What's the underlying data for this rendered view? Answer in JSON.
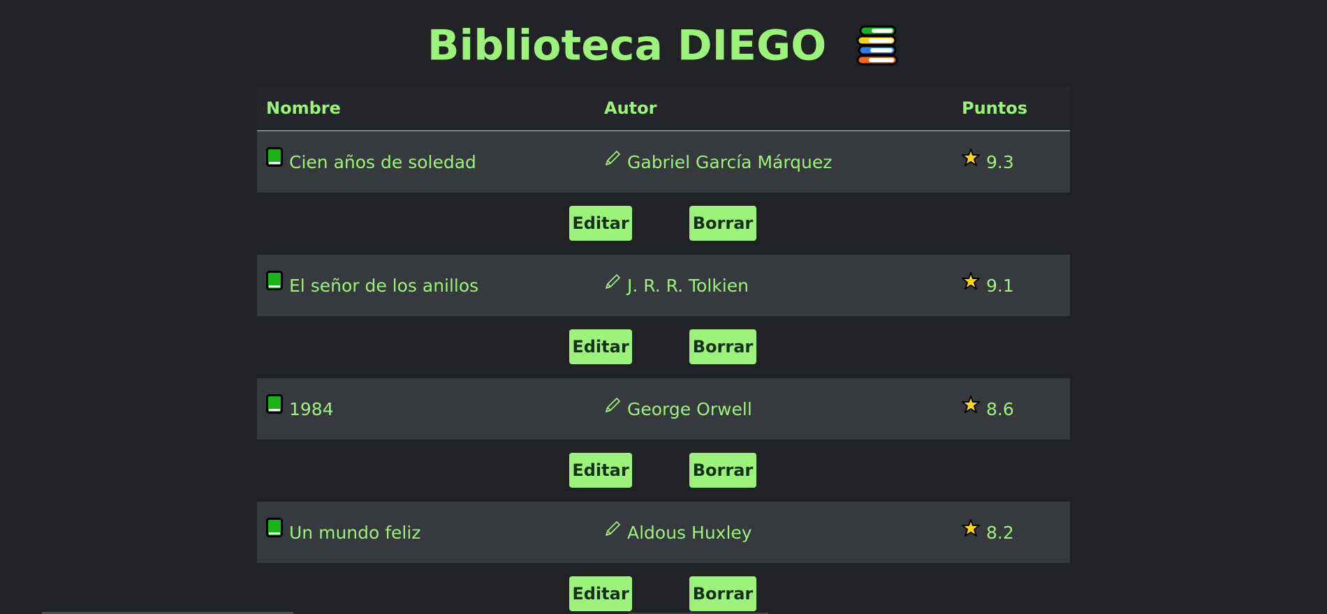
{
  "app": {
    "title": "Biblioteca DIEGO",
    "title_icon": "books-stack-icon"
  },
  "colors": {
    "accent": "#9cf27a",
    "background": "#202226",
    "row_background": "#363a3e",
    "button_text": "#15301a",
    "book_icon": "#18b418",
    "star": "#ffd21f"
  },
  "table": {
    "headers": {
      "name": "Nombre",
      "author": "Autor",
      "points": "Puntos"
    },
    "rows": [
      {
        "name": "Cien años de soledad",
        "author": "Gabriel García Márquez",
        "points": "9.3",
        "edit_label": "Editar",
        "delete_label": "Borrar"
      },
      {
        "name": "El señor de los anillos",
        "author": "J. R. R. Tolkien",
        "points": "9.1",
        "edit_label": "Editar",
        "delete_label": "Borrar"
      },
      {
        "name": "1984",
        "author": "George Orwell",
        "points": "8.6",
        "edit_label": "Editar",
        "delete_label": "Borrar"
      },
      {
        "name": "Un mundo feliz",
        "author": "Aldous Huxley",
        "points": "8.2",
        "edit_label": "Editar",
        "delete_label": "Borrar"
      }
    ]
  }
}
